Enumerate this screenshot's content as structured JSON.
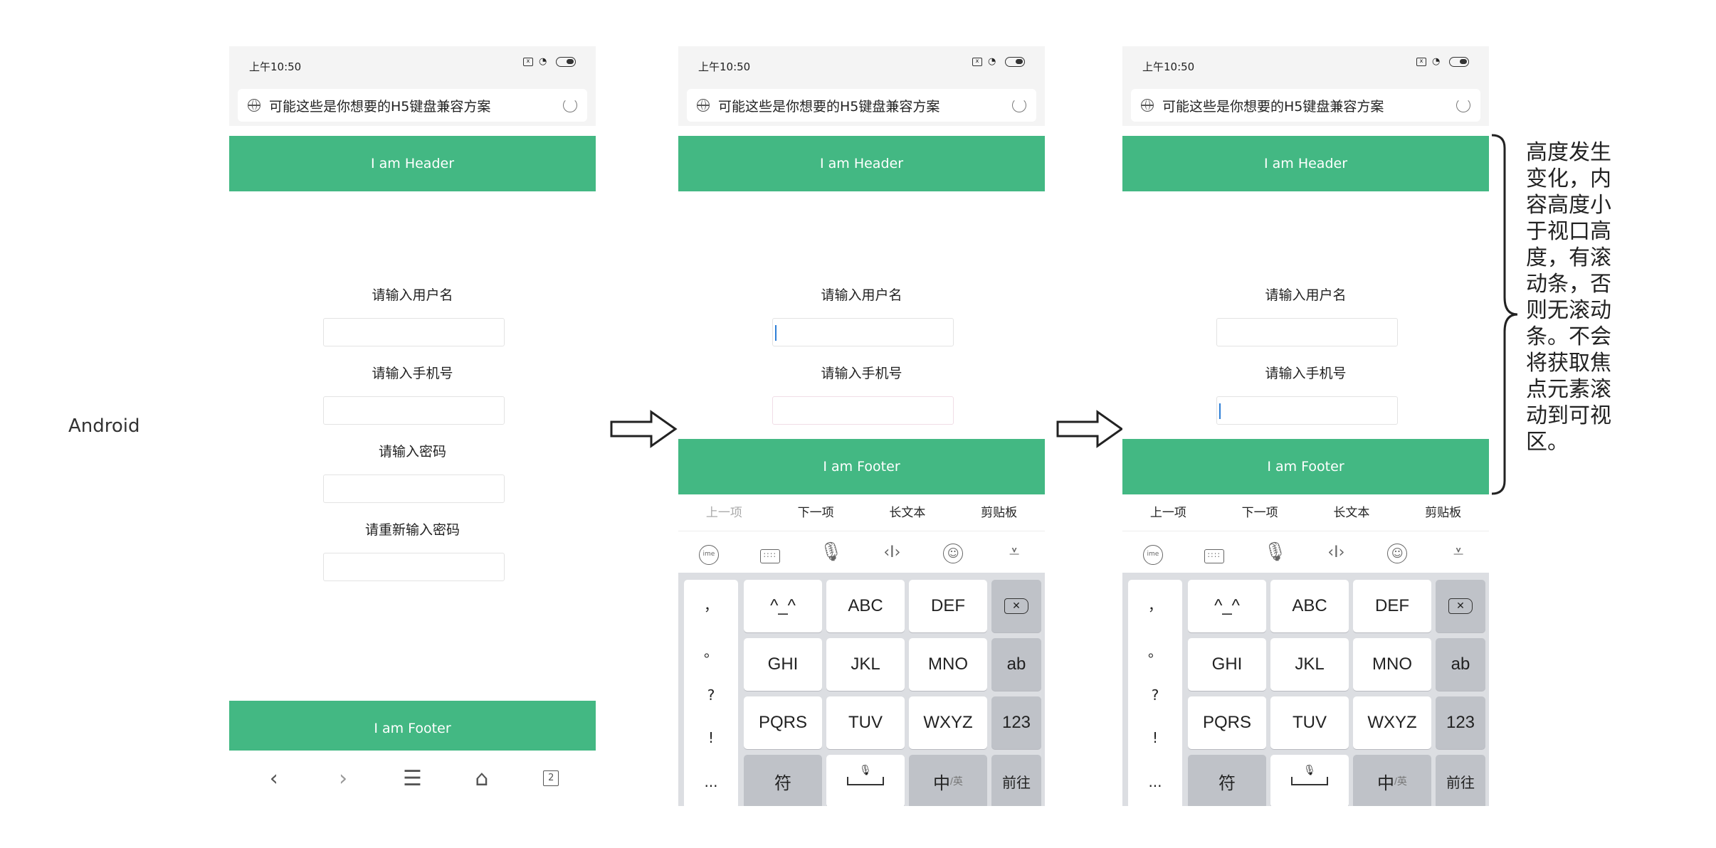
{
  "platform_label": "Android",
  "phones": [
    {
      "status_time": "上午10:50",
      "url_title": "可能这些是你想要的H5键盘兼容方案",
      "header_text": "I am Header",
      "fields": [
        "请输入用户名",
        "请输入手机号",
        "请输入密码",
        "请重新输入密码"
      ],
      "footer_text": "I am Footer",
      "nav_tab_count": "2"
    },
    {
      "status_time": "上午10:50",
      "url_title": "可能这些是你想要的H5键盘兼容方案",
      "header_text": "I am Header",
      "fields": [
        "请输入用户名",
        "请输入手机号"
      ],
      "footer_text": "I am Footer"
    },
    {
      "status_time": "上午10:50",
      "url_title": "可能这些是你想要的H5键盘兼容方案",
      "header_text": "I am Header",
      "fields": [
        "请输入用户名",
        "请输入手机号"
      ],
      "footer_text": "I am Footer"
    }
  ],
  "toolbar": {
    "prev": "上一项",
    "next": "下一项",
    "long_text": "长文本",
    "clipboard": "剪贴板"
  },
  "keyboard": {
    "punct": [
      "，",
      "。",
      "?",
      "!",
      "..."
    ],
    "row1": [
      "^_^",
      "ABC",
      "DEF"
    ],
    "row2": [
      "GHI",
      "JKL",
      "MNO",
      "ab"
    ],
    "row3": [
      "PQRS",
      "TUV",
      "WXYZ",
      "123"
    ],
    "symbol": "符",
    "lang": "中",
    "lang_sub": "/英",
    "go": "前往"
  },
  "note": "高度发生变化，内容高度小于视口高度，有滚动条，否则无滚动条。不会将获取焦点元素滚动到可视区。",
  "colors": {
    "accent": "#43b883",
    "keyboard_bg": "#dcdee2"
  },
  "icons": [
    "sim-icon",
    "wifi-icon",
    "battery-icon",
    "globe-icon",
    "reload-icon",
    "back-icon",
    "forward-icon",
    "menu-icon",
    "home-icon",
    "tabs-icon",
    "arrow-right-icon",
    "brace-icon"
  ]
}
